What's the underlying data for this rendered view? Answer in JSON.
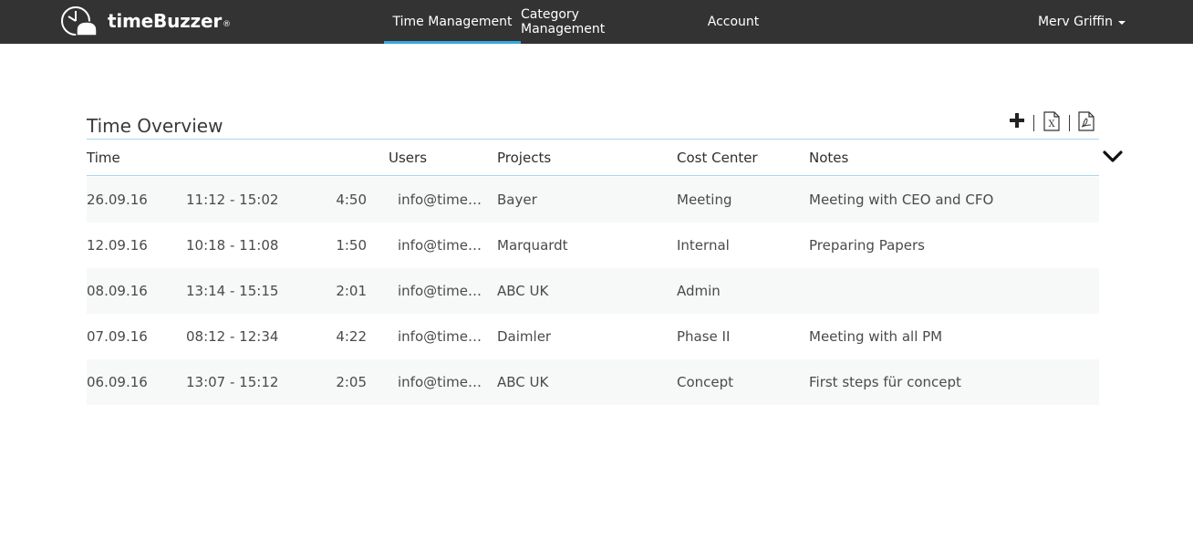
{
  "app": {
    "logo_text": "timeBuzzer",
    "logo_mark": "®"
  },
  "nav": {
    "items": [
      {
        "label": "Time Management",
        "active": true
      },
      {
        "label": "Category Management",
        "active": false
      },
      {
        "label": "Account",
        "active": false
      }
    ],
    "user": "Merv Griffin"
  },
  "main": {
    "title": "Time Overview",
    "toolbar": {
      "add_icon": "plus-icon",
      "excel_icon": "excel-export-icon",
      "pdf_icon": "pdf-export-icon"
    },
    "columns": [
      "Time",
      "Users",
      "Projects",
      "Cost Center",
      "Notes"
    ],
    "rows": [
      {
        "date": "26.09.16",
        "range": "11:12 - 15:02",
        "duration": "4:50",
        "user": "info@timebuzzer.com",
        "project": "Bayer",
        "cost_center": "Meeting",
        "note": "Meeting with CEO and CFO"
      },
      {
        "date": "12.09.16",
        "range": "10:18 - 11:08",
        "duration": "1:50",
        "user": "info@timebuzzer.com",
        "project": "Marquardt",
        "cost_center": "Internal",
        "note": "Preparing Papers"
      },
      {
        "date": "08.09.16",
        "range": "13:14 - 15:15",
        "duration": "2:01",
        "user": "info@timebuzzer.com",
        "project": "ABC UK",
        "cost_center": "Admin",
        "note": ""
      },
      {
        "date": "07.09.16",
        "range": "08:12 - 12:34",
        "duration": "4:22",
        "user": "info@timebuzzer.com",
        "project": "Daimler",
        "cost_center": "Phase II",
        "note": "Meeting with all PM"
      },
      {
        "date": "06.09.16",
        "range": "13:07 - 15:12",
        "duration": "2:05",
        "user": "info@timebuzzer.com",
        "project": "ABC UK",
        "cost_center": "Concept",
        "note": "First steps für concept"
      }
    ]
  },
  "colors": {
    "navbar_bg": "#333333",
    "accent": "#3aa7e0",
    "row_alt": "#f7f8f8"
  }
}
